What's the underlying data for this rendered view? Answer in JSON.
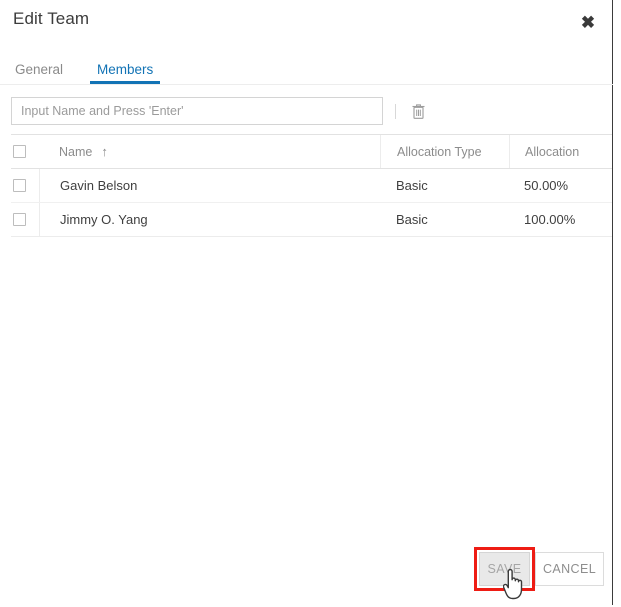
{
  "dialog": {
    "title": "Edit Team",
    "close_icon": "close-icon",
    "close_label": "✖"
  },
  "tabs": [
    {
      "label": "General",
      "active": false
    },
    {
      "label": "Members",
      "active": true
    }
  ],
  "member_input": {
    "placeholder": "Input Name and Press 'Enter'",
    "value": "",
    "delete_icon": "trash-icon"
  },
  "table": {
    "sort_indicator": "↑",
    "columns": [
      {
        "key": "select",
        "label": ""
      },
      {
        "key": "name",
        "label": "Name"
      },
      {
        "key": "allocation_type",
        "label": "Allocation Type"
      },
      {
        "key": "allocation",
        "label": "Allocation"
      }
    ],
    "rows": [
      {
        "selected": false,
        "name": "Gavin Belson",
        "allocation_type": "Basic",
        "allocation": "50.00%"
      },
      {
        "selected": false,
        "name": "Jimmy O. Yang",
        "allocation_type": "Basic",
        "allocation": "100.00%"
      }
    ]
  },
  "footer": {
    "save_label": "SAVE",
    "cancel_label": "CANCEL"
  },
  "colors": {
    "accent": "#1273b5",
    "annotation": "#ee1c14",
    "text": "#3c3c3c",
    "muted": "#8c8c8c",
    "save_fill": "#e9e9e9"
  }
}
